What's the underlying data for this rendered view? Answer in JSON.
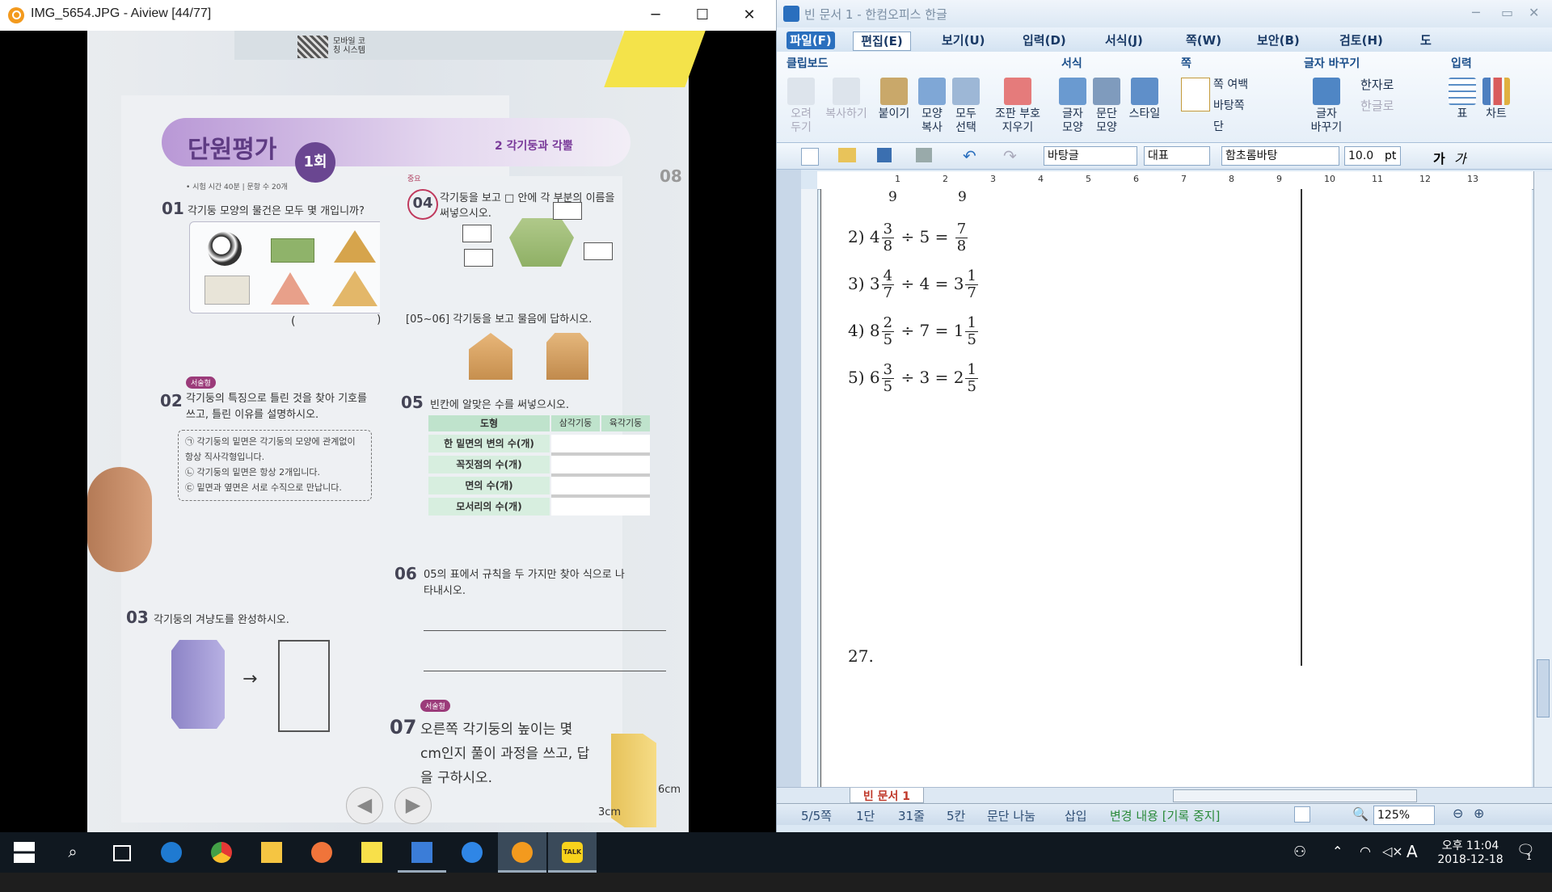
{
  "aiview": {
    "title": "IMG_5654.JPG - Aiview [44/77]",
    "photo": {
      "header_title": "단원평가",
      "round": "1회",
      "unit": "2 각기둥과 각뿔",
      "meta": "• 시험 시간 40분 | 문항 수 20개",
      "q01_num": "01",
      "q01": "각기둥 모양의 물건은 모두 몇 개입니까?",
      "q02_num": "02",
      "q02_tag": "서술형",
      "q02": "각기둥의 특징으로 틀린 것을 찾아 기호를 쓰고, 틀린 이유를 설명하시오.",
      "q02_opt1": "㉠ 각기둥의 밑면은 각기둥의 모양에 관계없이 항상 직사각형입니다.",
      "q02_opt2": "㉡ 각기둥의 밑면은 항상 2개입니다.",
      "q02_opt3": "㉢ 밑면과 옆면은 서로 수직으로 만납니다.",
      "q03_num": "03",
      "q03": "각기둥의 겨냥도를 완성하시오.",
      "q04_num": "04",
      "q04_tag": "중요",
      "q04": "각기둥을 보고 □ 안에 각 부분의 이름을 써넣으시오.",
      "q0506": "[05~06] 각기둥을 보고 물음에 답하시오.",
      "q05_num": "05",
      "q05": "빈칸에 알맞은 수를 써넣으시오.",
      "table_headers": [
        "도형",
        "삼각기둥",
        "육각기둥"
      ],
      "table_rows": [
        "한 밑면의 변의 수(개)",
        "꼭짓점의 수(개)",
        "면의 수(개)",
        "모서리의 수(개)"
      ],
      "q06_num": "06",
      "q06": "05의 표에서 규칙을 두 가지만 찾아 식으로 나타내시오.",
      "q07_num": "07",
      "q07_tag": "서술형",
      "q07": "오른쪽 각기둥의 높이는 몇 cm인지 풀이 과정을 쓰고, 답을 구하시오.",
      "dim_6cm": "6cm",
      "dim_3cm": "3cm",
      "q08_num": "08",
      "mobile": "모바일 코칭 시스템",
      "paren_open": "(",
      "paren_close": ")"
    }
  },
  "hwp": {
    "title": "빈 문서 1 - 한컴오피스 한글",
    "menus": [
      "파일(F)",
      "편집(E)",
      "보기(U)",
      "입력(D)",
      "서식(J)",
      "쪽(W)",
      "보안(B)",
      "검토(H)",
      "도"
    ],
    "groups": {
      "clipboard": "클립보드",
      "format": "서식",
      "page": "쪽",
      "replace": "글자 바꾸기",
      "input": "입력"
    },
    "buttons": {
      "cut": "오려\n두기",
      "copy": "복사하기",
      "paste": "붙이기",
      "shape_copy": "모양\n복사",
      "select_all": "모두\n선택",
      "clear_marks": "조판 부호\n지우기",
      "char_shape": "글자\n모양",
      "para_shape": "문단\n모양",
      "style": "스타일",
      "page_margin": "쪽 여백",
      "landscape": "바탕쪽",
      "column": "단",
      "hanja": "한자로",
      "hangul": "한글로",
      "char_replace": "글자\n바꾸기",
      "table": "표",
      "chart": "차트"
    },
    "toolbar": {
      "style": "바탕글",
      "font_lang": "대표",
      "font": "함초롬바탕",
      "size": "10.0",
      "unit": "pt",
      "bold_label": "가",
      "italic_label": "가"
    },
    "ruler_ticks": [
      "1",
      "2",
      "3",
      "4",
      "5",
      "6",
      "7",
      "8",
      "9",
      "10",
      "11",
      "12",
      "13"
    ],
    "document": {
      "top_fragment_left": "9",
      "top_fragment_right": "9",
      "lines": [
        {
          "label": "2)",
          "whole": "4",
          "n": "3",
          "d": "8",
          "op": "÷ 5 =",
          "rwhole": "",
          "rn": "7",
          "rd": "8"
        },
        {
          "label": "3)",
          "whole": "3",
          "n": "4",
          "d": "7",
          "op": "÷ 4 = 3",
          "rwhole": "",
          "rn": "1",
          "rd": "7"
        },
        {
          "label": "4)",
          "whole": "8",
          "n": "2",
          "d": "5",
          "op": "÷ 7 = 1",
          "rwhole": "",
          "rn": "1",
          "rd": "5"
        },
        {
          "label": "5)",
          "whole": "6",
          "n": "3",
          "d": "5",
          "op": "÷ 3 = 2",
          "rwhole": "",
          "rn": "1",
          "rd": "5"
        }
      ],
      "item27": "27."
    },
    "tab": "빈 문서 1",
    "status": {
      "page": "5/5쪽",
      "column": "1단",
      "line": "31줄",
      "col": "5칸",
      "para": "문단 나눔",
      "mode": "삽입",
      "track": "변경 내용 [기록 중지]",
      "zoom": "125%"
    }
  },
  "taskbar": {
    "time": "오후 11:04",
    "date": "2018-12-18",
    "ime": "A",
    "notif_count": "1",
    "apps": [
      "start-icon",
      "search-icon",
      "task-view-icon",
      "edge-icon",
      "chrome-icon",
      "file-explorer-icon",
      "pen-app-icon",
      "sticky-notes-icon",
      "hancom-icon",
      "arrow-app-icon",
      "aiview-icon",
      "kakaotalk-icon"
    ],
    "kakao_label": "TALK"
  }
}
